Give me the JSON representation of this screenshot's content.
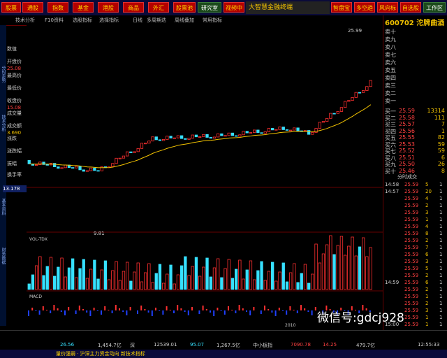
{
  "menu": {
    "left": [
      "股票",
      "基金",
      "商品"
    ],
    "items": [
      "通股",
      "指数",
      "基金",
      "港股",
      "商品",
      "外汇",
      "股票池",
      "研究室",
      "视频中心",
      "智盘宝",
      "内部",
      "多空趋势",
      "风向标",
      "自选股",
      "市场快讯",
      "工作区"
    ],
    "brand": "大智慧金融终端"
  },
  "toolbar": [
    "技术分析",
    "F10资料",
    "选股指标",
    "选择指标",
    "日线",
    "多周期迭",
    "周线叠加",
    "常用指标"
  ],
  "left": {
    "labels": [
      "数值",
      "开盘价",
      "最高价",
      "最低价",
      "收盘价",
      "成交量",
      "成交额",
      "涨跌",
      "涨跌幅",
      "振幅",
      "换手率"
    ],
    "values": [
      "25.08",
      "15.08",
      "13.55",
      "3.690"
    ]
  },
  "vtabs": [
    "分时走势",
    "技术分析",
    "基本资料",
    "财务数据"
  ],
  "chart": {
    "price_label_left": "13.178",
    "peak_label": "25.99",
    "low_label": "9.81",
    "indicator_line": "MA5   1014     成交量    1 2 5 7 1  7 5 0 0 万  换手率   2 . 6 8 %  市值  2 5 . 3 1 亿",
    "vol_label": "VOL-TDX",
    "macd_label": "MACD",
    "date_label": "2010"
  },
  "right": {
    "code": "600702 沱牌曲酒",
    "asks": [
      {
        "l": "卖十"
      },
      {
        "l": "卖九"
      },
      {
        "l": "卖八"
      },
      {
        "l": "卖七"
      },
      {
        "l": "卖六"
      },
      {
        "l": "卖五"
      },
      {
        "l": "卖四"
      },
      {
        "l": "卖三"
      },
      {
        "l": "卖二"
      },
      {
        "l": "卖一"
      }
    ],
    "bids": [
      {
        "l": "买一",
        "p": "25.59",
        "v": "13314"
      },
      {
        "l": "买二",
        "p": "25.58",
        "v": "111"
      },
      {
        "l": "买三",
        "p": "25.57",
        "v": "7"
      },
      {
        "l": "买四",
        "p": "25.56",
        "v": "1"
      },
      {
        "l": "买五",
        "p": "25.55",
        "v": "82"
      },
      {
        "l": "买六",
        "p": "25.53",
        "v": "59"
      },
      {
        "l": "买七",
        "p": "25.52",
        "v": "59"
      },
      {
        "l": "买八",
        "p": "25.51",
        "v": "6"
      },
      {
        "l": "买九",
        "p": "25.50",
        "v": "26"
      },
      {
        "l": "买十",
        "p": "25.46",
        "v": "8"
      }
    ],
    "tab": "分时成交",
    "ticks": [
      {
        "t": "14:58",
        "p": "25.59",
        "v": "5",
        "s": "1"
      },
      {
        "t": "14:57",
        "p": "25.59",
        "v": "20",
        "s": "1"
      },
      {
        "t": "",
        "p": "25.59",
        "v": "4",
        "s": "1"
      },
      {
        "t": "",
        "p": "25.59",
        "v": "2",
        "s": "1"
      },
      {
        "t": "",
        "p": "25.59",
        "v": "3",
        "s": "1"
      },
      {
        "t": "",
        "p": "25.59",
        "v": "1",
        "s": "1"
      },
      {
        "t": "",
        "p": "25.59",
        "v": "4",
        "s": "1"
      },
      {
        "t": "",
        "p": "25.59",
        "v": "8",
        "s": "1"
      },
      {
        "t": "",
        "p": "25.59",
        "v": "2",
        "s": "1"
      },
      {
        "t": "",
        "p": "25.59",
        "v": "7",
        "s": "1"
      },
      {
        "t": "",
        "p": "25.59",
        "v": "6",
        "s": "1"
      },
      {
        "t": "",
        "p": "25.59",
        "v": "3",
        "s": "1"
      },
      {
        "t": "",
        "p": "25.59",
        "v": "5",
        "s": "1"
      },
      {
        "t": "",
        "p": "25.59",
        "v": "2",
        "s": "1"
      },
      {
        "t": "14:59",
        "p": "25.59",
        "v": "6",
        "s": "1"
      },
      {
        "t": "",
        "p": "25.59",
        "v": "2",
        "s": "1"
      },
      {
        "t": "",
        "p": "25.59",
        "v": "1",
        "s": "1"
      },
      {
        "t": "",
        "p": "25.59",
        "v": "2",
        "s": "1"
      },
      {
        "t": "",
        "p": "25.59",
        "v": "3",
        "s": "1"
      },
      {
        "t": "",
        "p": "25.59",
        "v": "1",
        "s": "1"
      },
      {
        "t": "15:00",
        "p": "25.59",
        "v": "1",
        "s": "1"
      }
    ]
  },
  "status": {
    "index1": "26.56",
    "index2": "1,454.7亿",
    "index3": "12539.01",
    "index4": "95.07",
    "index5": "1,267.5亿",
    "index6": "7090.78",
    "index7": "14.25",
    "index8": "479.7亿",
    "text1": "深",
    "text2": "中小板指",
    "time": "12:55:33"
  },
  "bottom": "量价强弱 · 沪深主力资金动向  新技术指标",
  "watermark": "微信号:gdcj928",
  "colors": {
    "up": "#ff3030",
    "down": "#36e0ff",
    "ma1": "#ffffff",
    "ma2": "#f2c200",
    "gold": "#f2c200"
  }
}
